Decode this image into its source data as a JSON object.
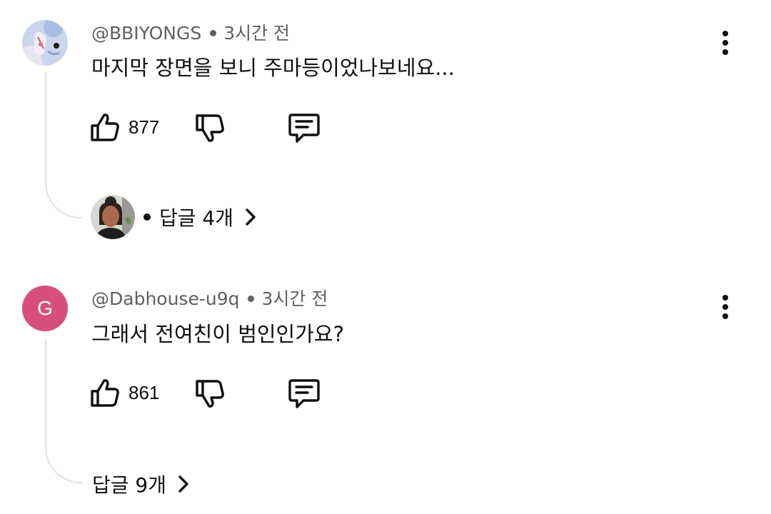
{
  "comments": [
    {
      "author": "@BBIYONGS",
      "time": "3시간 전",
      "text": "마지막 장면을 보니 주마등이었나보네요...",
      "likes": "877",
      "replies_label": "답글 4개",
      "avatar_icon": "illustrated-profile-avatar",
      "reply_avatar_icon": "replier-photo-avatar"
    },
    {
      "author": "@Dabhouse-u9q",
      "time": "3시간 전",
      "text": "그래서 전여친이 범인인가요?",
      "likes": "861",
      "replies_label": "답글 9개",
      "avatar_letter": "G",
      "avatar_color": "#d84f7f"
    }
  ]
}
